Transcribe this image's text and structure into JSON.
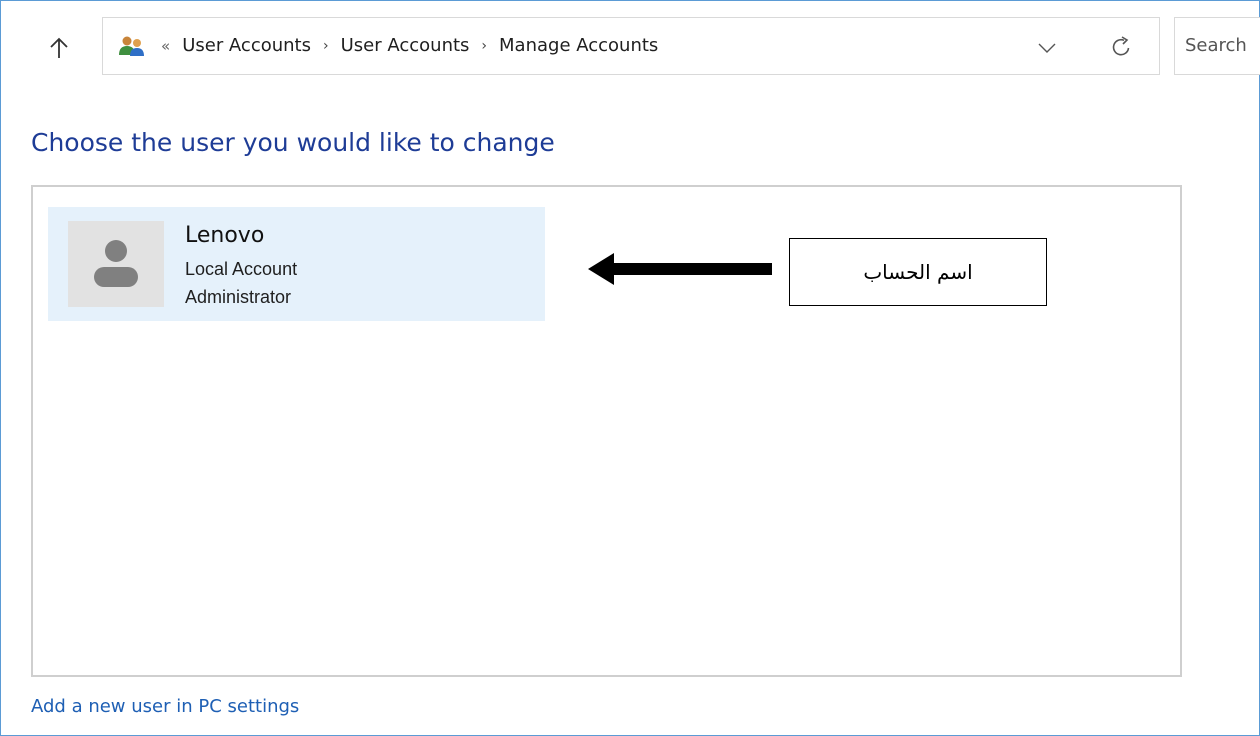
{
  "address_bar": {
    "overflow_glyph": "«",
    "breadcrumbs": [
      "User Accounts",
      "User Accounts",
      "Manage Accounts"
    ],
    "separator": "›",
    "icon": "users-icon"
  },
  "search": {
    "placeholder": "Search"
  },
  "main": {
    "heading": "Choose the user you would like to change",
    "accounts": [
      {
        "name": "Lenovo",
        "type": "Local Account",
        "role": "Administrator",
        "avatar_icon": "user-avatar-icon"
      }
    ],
    "add_user_link": "Add a new user in PC settings"
  },
  "annotation": {
    "label": "اسم الحساب"
  },
  "colors": {
    "heading": "#1e3c96",
    "link": "#1e5fb4",
    "tile_selected": "#e5f1fb",
    "window_border": "#5b9bd5"
  }
}
